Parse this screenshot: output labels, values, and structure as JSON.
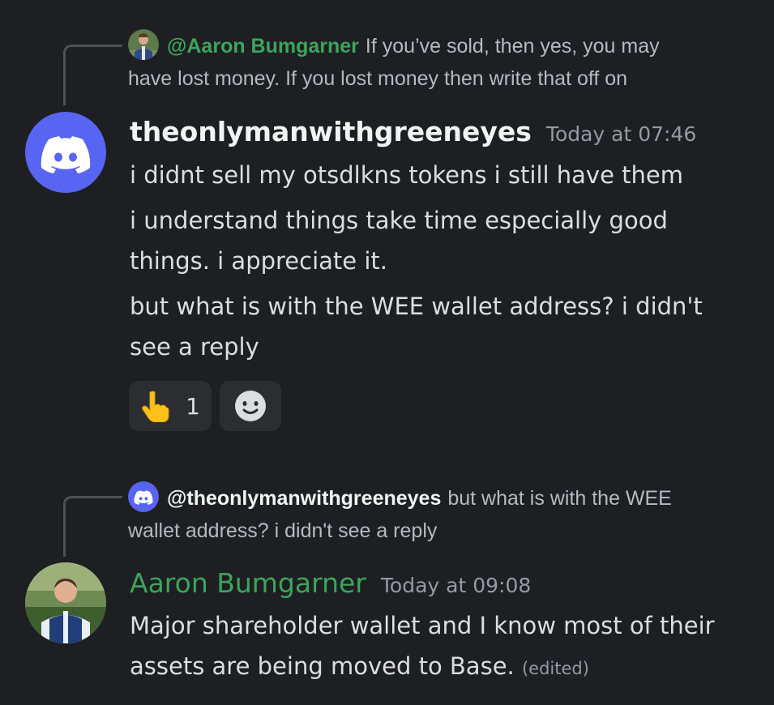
{
  "message1": {
    "reply": {
      "mention": "@Aaron Bumgarner",
      "preview_line1": "If you’ve sold, then yes, you may",
      "preview_line2": "have lost money. If you lost money then write that off on"
    },
    "username": "theonlymanwithgreeneyes",
    "timestamp": "Today at 07:46",
    "lines": [
      "i didnt sell my otsdlkns tokens i still have them",
      "i understand things take time especially good things. i appreciate it.",
      "but what is with the WEE wallet address? i didn't see a reply"
    ],
    "reaction": {
      "icon": "pointing-finger",
      "count": "1"
    },
    "add_reaction_icon": "smiley-icon"
  },
  "message2": {
    "reply": {
      "mention": "@theonlymanwithgreeneyes",
      "preview_line1": "but what is with the WEE",
      "preview_line2": "wallet address? i didn't see a reply"
    },
    "username": "Aaron Bumgarner",
    "timestamp": "Today at 09:08",
    "text": "Major shareholder wallet and I know most of their assets are being moved to Base.",
    "edited": "(edited)"
  },
  "colors": {
    "background": "#1e1f22",
    "discord_blurple": "#5865f2",
    "username_green": "#3ba55c",
    "reaction_bg": "#2b2d31"
  }
}
